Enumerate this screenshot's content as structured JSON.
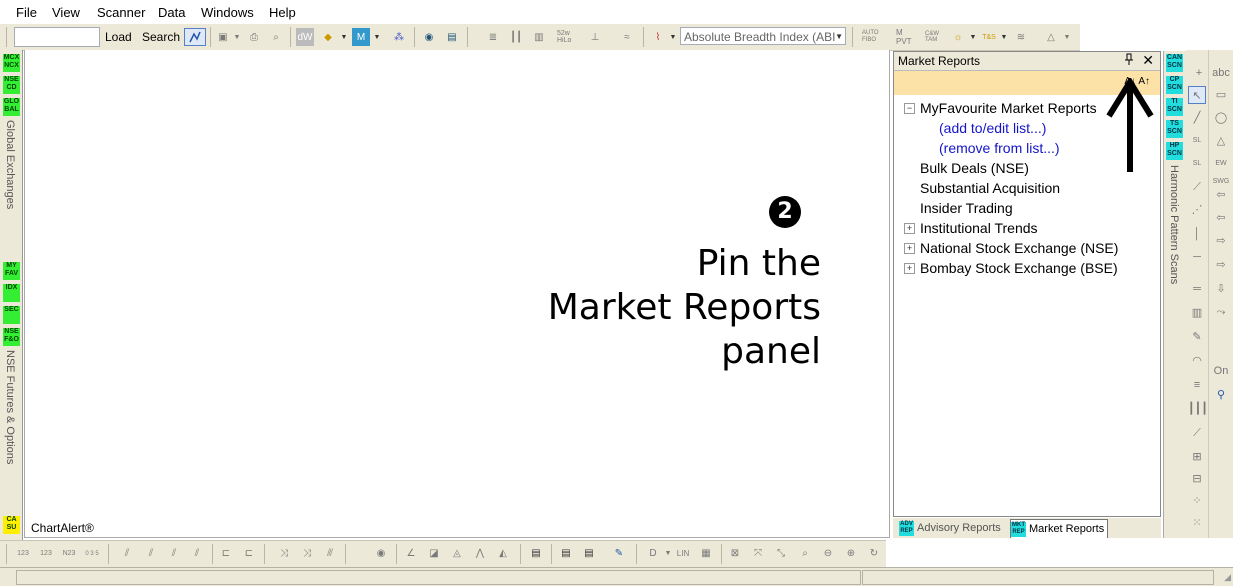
{
  "menu": {
    "items": [
      "File",
      "View",
      "Scanner",
      "Data",
      "Windows",
      "Help"
    ]
  },
  "toolbar": {
    "symbol_value": "",
    "load_label": "Load",
    "search_label": "Search",
    "indicator_select_value": "Absolute Breadth Index (ABI",
    "chart_icon_labels": [
      "52w HiLo",
      "AUTO FIBO",
      "M PVT",
      "C&W TAM",
      "T&S"
    ]
  },
  "left_sidebar": {
    "top_tags": [
      "MCX NCX",
      "NSE CD",
      "GLO BAL"
    ],
    "top_label": "Global Exchanges",
    "mid_tags": [
      "MY FAV",
      "IDX",
      "SEC",
      "NSE F&O"
    ],
    "mid_label": "NSE Futures & Options",
    "bottom_tag": "CA SU"
  },
  "chart": {
    "footer_label": "ChartAlert®",
    "step_number": "2",
    "instruction_lines": [
      "Pin the",
      "Market Reports",
      "panel"
    ]
  },
  "market_reports": {
    "title": "Market Reports",
    "pin_icon": "pin-icon",
    "close_label": "✕",
    "font_size_label": "A↓ A↑",
    "tree": [
      {
        "label": "MyFavourite Market Reports",
        "expander": "−"
      },
      {
        "label": "(add to/edit list...)"
      },
      {
        "label": "(remove from list...)"
      },
      {
        "label": "Bulk Deals (NSE)"
      },
      {
        "label": "Substantial Acquisition"
      },
      {
        "label": "Insider Trading"
      },
      {
        "label": "Institutional Trends",
        "expander": "+"
      },
      {
        "label": "National Stock Exchange (NSE)",
        "expander": "+"
      },
      {
        "label": "Bombay Stock Exchange (BSE)",
        "expander": "+"
      }
    ],
    "tabs": [
      {
        "icon": "ADV REP",
        "label": "Advisory Reports"
      },
      {
        "icon": "MKT REP",
        "label": "Market Reports"
      }
    ]
  },
  "scans": {
    "tags": [
      "CAN SCN",
      "CP SCN",
      "TI SCN",
      "TS SCN",
      "HP SCN"
    ],
    "label": "Harmonic Pattern Scans"
  },
  "draw_tools": {
    "col1": [
      "abc",
      "▭",
      "◯",
      "△",
      "EW SWG"
    ],
    "col2": [
      "+",
      "↖",
      "╱",
      "SL",
      "SL"
    ],
    "text_label": "On"
  },
  "bottom_toolbar": {
    "icons": [
      "123",
      "123",
      "N23",
      "0 3 5",
      "LIN"
    ]
  },
  "colors": {
    "accent_green": "#33ee33",
    "accent_cyan": "#22dddd",
    "panel_header": "#fde2a8",
    "link_blue": "#1414c8"
  }
}
